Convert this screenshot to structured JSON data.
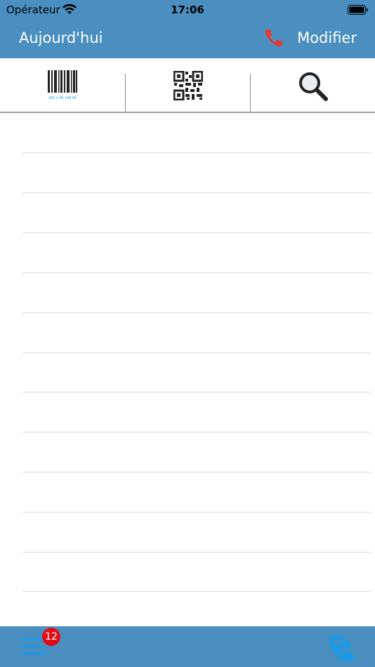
{
  "status_bar": {
    "carrier": "Opérateur",
    "time": "17:06",
    "wifi_icon": "wifi-icon",
    "battery_icon": "battery-icon"
  },
  "nav": {
    "left_label": "Aujourd'hui",
    "right_label": "Modifier",
    "phone_icon": "phone-icon",
    "phone_color": "#e53935"
  },
  "toolbar": {
    "barcode_number": "432 1 45 148 46",
    "barcode_icon": "barcode-icon",
    "qrcode_icon": "qrcode-icon",
    "search_icon": "search-icon"
  },
  "list": {
    "rows": [
      "",
      "",
      "",
      "",
      "",
      "",
      "",
      "",
      "",
      "",
      "",
      "",
      ""
    ]
  },
  "tab_bar": {
    "menu_icon": "menu-icon",
    "badge_count": "12",
    "map_user_icon": "map-user-icon",
    "accent_color": "#1e9be6"
  },
  "colors": {
    "header_bg": "#4a8fc0",
    "divider": "#dcdcdc"
  }
}
